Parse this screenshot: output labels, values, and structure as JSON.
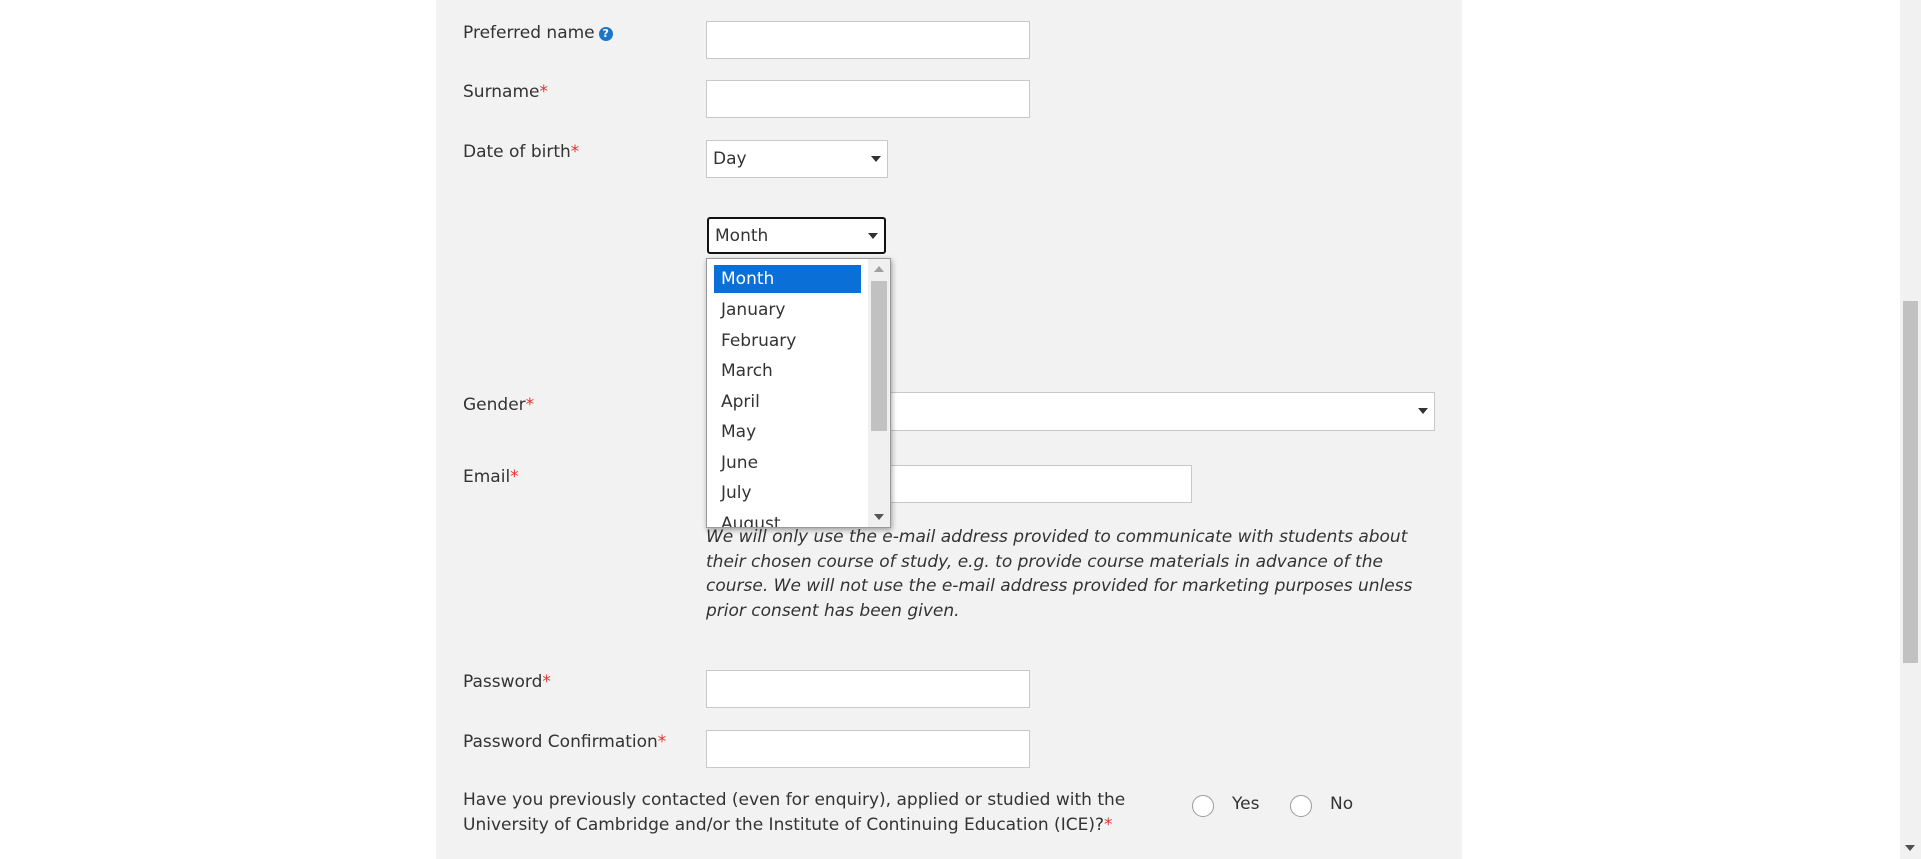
{
  "form": {
    "preferred_name": {
      "label": "Preferred name",
      "help_icon": "question-circle-icon",
      "value": ""
    },
    "surname": {
      "label": "Surname",
      "required_mark": "*",
      "value": ""
    },
    "dob": {
      "label": "Date of birth",
      "required_mark": "*",
      "day_value": "Day",
      "month_value": "Month",
      "month_options": [
        "Month",
        "January",
        "February",
        "March",
        "April",
        "May",
        "June",
        "July",
        "August"
      ]
    },
    "gender": {
      "label": "Gender",
      "required_mark": "*",
      "value": ""
    },
    "email": {
      "label": "Email",
      "required_mark": "*",
      "value": "",
      "note": "We will only use the e-mail address provided to communicate with students about their chosen course of study, e.g. to provide course materials in advance of the course. We will not use the e-mail address provided for marketing purposes unless prior consent has been given."
    },
    "password": {
      "label": "Password",
      "required_mark": "*",
      "value": ""
    },
    "password_confirmation": {
      "label": "Password Confirmation",
      "required_mark": "*",
      "value": ""
    },
    "previous_contact": {
      "question": "Have you previously contacted (even for enquiry), applied or studied with the University of Cambridge and/or the Institute of Continuing Education (ICE)?",
      "required_mark": "*",
      "yes_label": "Yes",
      "no_label": "No"
    }
  },
  "colors": {
    "panel_bg": "#f2f2f2",
    "required": "#e0342e",
    "selected_option": "#0a6fd6",
    "help_icon": "#1d75c7"
  }
}
